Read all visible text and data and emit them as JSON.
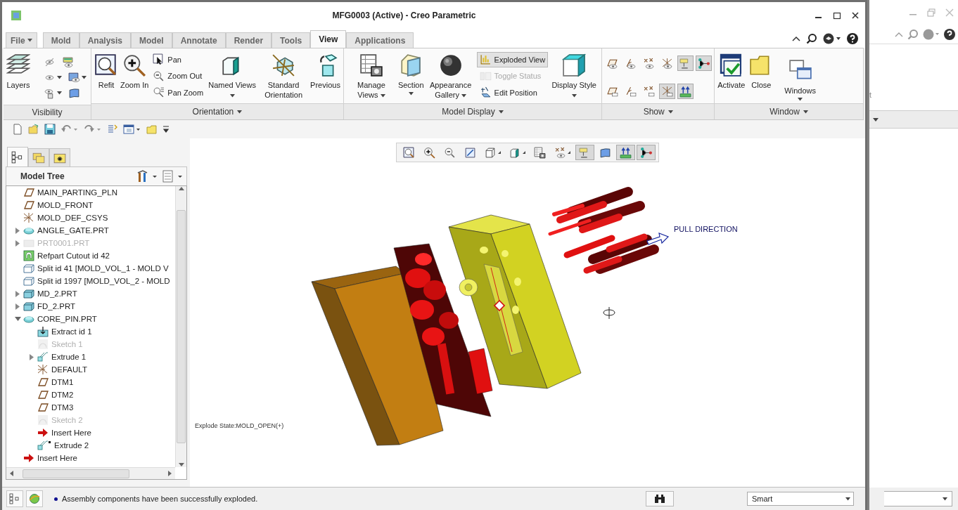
{
  "window": {
    "title": "MFG0003 (Active) - Creo Parametric"
  },
  "ribbon_tabs": [
    {
      "label": "File",
      "kind": "menu",
      "selected": false
    },
    {
      "label": "Mold",
      "kind": "tab",
      "selected": false
    },
    {
      "label": "Analysis",
      "kind": "tab",
      "selected": false
    },
    {
      "label": "Model",
      "kind": "tab",
      "selected": false
    },
    {
      "label": "Annotate",
      "kind": "tab",
      "selected": false
    },
    {
      "label": "Render",
      "kind": "tab",
      "selected": false
    },
    {
      "label": "Tools",
      "kind": "tab",
      "selected": false
    },
    {
      "label": "View",
      "kind": "tab",
      "selected": true
    },
    {
      "label": "Applications",
      "kind": "tab",
      "selected": false
    }
  ],
  "ribbon_groups": [
    {
      "label": "Visibility",
      "menu": false,
      "tools": [
        {
          "kind": "large",
          "label": "Layers",
          "dropdown": false
        },
        {
          "kind": "grid",
          "rows": [
            [
              {
                "caret": false,
                "on": false
              },
              {
                "caret": false,
                "on": false
              }
            ],
            [
              {
                "caret": true,
                "on": false
              },
              {
                "caret": true,
                "on": false
              }
            ],
            [
              {
                "caret": true,
                "on": false
              },
              {
                "caret": false,
                "on": false
              }
            ]
          ]
        }
      ]
    },
    {
      "label": "Orientation",
      "menu": true,
      "tools": [
        {
          "kind": "large",
          "label": "Refit",
          "dropdown": false
        },
        {
          "kind": "large",
          "label": "Zoom In",
          "dropdown": false
        },
        {
          "kind": "stack",
          "items": [
            {
              "label": "Pan",
              "selected": false,
              "disabled": false
            },
            {
              "label": "Zoom Out",
              "selected": false,
              "disabled": false
            },
            {
              "label": "Pan Zoom",
              "selected": false,
              "disabled": false
            }
          ]
        },
        {
          "kind": "large",
          "label": "Named Views",
          "dropdown": true
        },
        {
          "kind": "large",
          "label": "Standard Orientation",
          "dropdown": false
        },
        {
          "kind": "large",
          "label": "Previous",
          "dropdown": false
        }
      ]
    },
    {
      "label": "Model Display",
      "menu": true,
      "tools": [
        {
          "kind": "large",
          "label": "Manage Views",
          "dropdown": true
        },
        {
          "kind": "split",
          "label": "Section"
        },
        {
          "kind": "large",
          "label": "Appearance Gallery",
          "dropdown": true
        },
        {
          "kind": "stack",
          "items": [
            {
              "label": "Exploded View",
              "selected": true,
              "disabled": false
            },
            {
              "label": "Toggle Status",
              "selected": false,
              "disabled": true
            },
            {
              "label": "Edit Position",
              "selected": false,
              "disabled": false
            }
          ]
        },
        {
          "kind": "large",
          "label": "Display Style",
          "dropdown": true
        }
      ]
    },
    {
      "label": "Show",
      "menu": true,
      "tools": [
        {
          "kind": "grid",
          "rows": [
            [
              {
                "caret": false,
                "on": false
              },
              {
                "caret": false,
                "on": false
              },
              {
                "caret": false,
                "on": false
              },
              {
                "caret": false,
                "on": false
              },
              {
                "caret": false,
                "on": true
              },
              {
                "caret": false,
                "on": true
              }
            ],
            [
              {
                "caret": false,
                "on": false
              },
              {
                "caret": false,
                "on": false
              },
              {
                "caret": false,
                "on": false
              },
              {
                "caret": false,
                "on": true
              },
              {
                "caret": false,
                "on": true
              }
            ]
          ]
        }
      ]
    },
    {
      "label": "Window",
      "menu": true,
      "tools": [
        {
          "kind": "large",
          "label": "Activate",
          "dropdown": false
        },
        {
          "kind": "large",
          "label": "Close",
          "dropdown": false
        },
        {
          "kind": "split",
          "label": "Windows"
        }
      ]
    }
  ],
  "navigator_tabs": [
    {
      "selected": true
    },
    {
      "selected": false
    },
    {
      "selected": false
    }
  ],
  "model_tree": {
    "title": "Model Tree",
    "items": [
      {
        "label": "MAIN_PARTING_PLN",
        "kind": "plane",
        "disabled": false
      },
      {
        "label": "MOLD_FRONT",
        "kind": "plane",
        "disabled": false
      },
      {
        "label": "MOLD_DEF_CSYS",
        "kind": "csys",
        "disabled": false
      },
      {
        "label": "ANGLE_GATE.PRT",
        "kind": "part",
        "expanded": false,
        "disabled": false
      },
      {
        "label": "PRT0001.PRT",
        "kind": "refpart",
        "expanded": false,
        "disabled": true
      },
      {
        "label": "Refpart Cutout id 42",
        "kind": "cutout",
        "disabled": false
      },
      {
        "label": "Split id 41 [MOLD_VOL_1 - MOLD V",
        "kind": "split",
        "disabled": false
      },
      {
        "label": "Split id 1997 [MOLD_VOL_2 - MOLD",
        "kind": "split",
        "disabled": false
      },
      {
        "label": "MD_2.PRT",
        "kind": "mold",
        "expanded": false,
        "disabled": false
      },
      {
        "label": "FD_2.PRT",
        "kind": "mold",
        "expanded": false,
        "disabled": false
      },
      {
        "label": "CORE_PIN.PRT",
        "kind": "part",
        "expanded": true,
        "disabled": false,
        "children": [
          {
            "label": "Extract id 1",
            "kind": "extract",
            "disabled": false
          },
          {
            "label": "Sketch 1",
            "kind": "sketch",
            "disabled": true
          },
          {
            "label": "Extrude 1",
            "kind": "extrude",
            "expanded": false,
            "disabled": false
          },
          {
            "label": "DEFAULT",
            "kind": "csys",
            "disabled": false
          },
          {
            "label": "DTM1",
            "kind": "plane",
            "disabled": false
          },
          {
            "label": "DTM2",
            "kind": "plane",
            "disabled": false
          },
          {
            "label": "DTM3",
            "kind": "plane",
            "disabled": false
          },
          {
            "label": "Sketch 2",
            "kind": "sketch",
            "disabled": true
          },
          {
            "label": "Insert Here",
            "kind": "insert",
            "disabled": false
          },
          {
            "label": "Extrude 2",
            "kind": "extrude_marked",
            "disabled": false
          }
        ]
      },
      {
        "label": "Insert Here",
        "kind": "insert",
        "disabled": false
      }
    ]
  },
  "view_toolbar": [
    {
      "on": false
    },
    {
      "on": false
    },
    {
      "on": false
    },
    {
      "on": false
    },
    {
      "on": false
    },
    {
      "on": false
    },
    {
      "on": false
    },
    {
      "on": false
    },
    {
      "on": true
    },
    {
      "on": false
    },
    {
      "on": true
    },
    {
      "on": true
    }
  ],
  "graphics": {
    "explode_state": "Explode State:MOLD_OPEN(+)",
    "pull_direction": "PULL DIRECTION"
  },
  "status_bar": {
    "message": "Assembly components have been successfully exploded.",
    "filter": "Smart"
  },
  "background_window": {
    "fragment": "t"
  }
}
